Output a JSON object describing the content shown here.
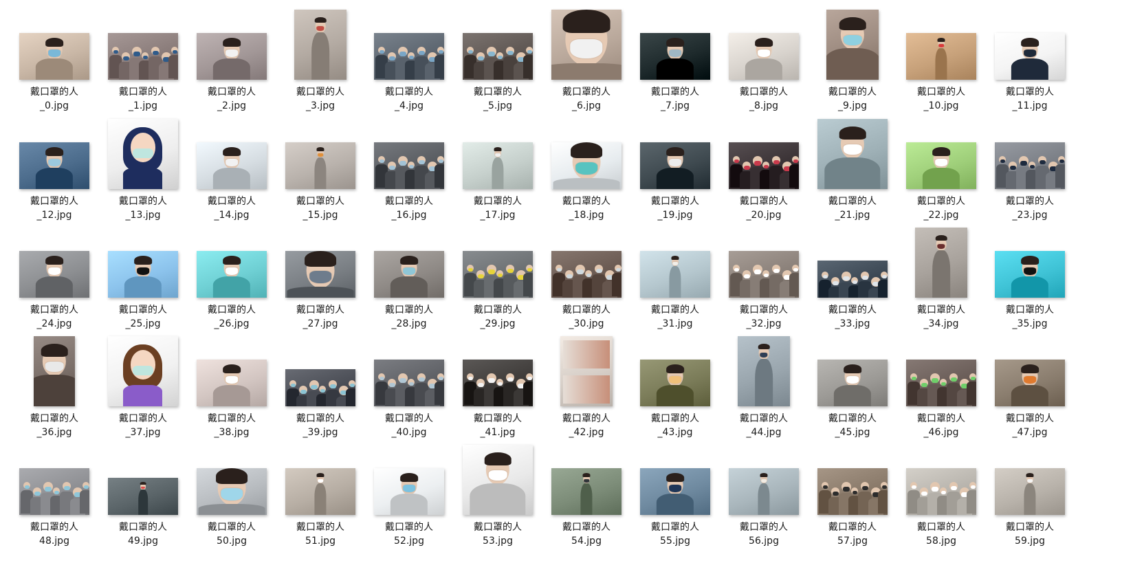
{
  "window": {
    "view": "large-icons",
    "background": "#ffffff"
  },
  "files": [
    {
      "name_line1": "戴口罩的人",
      "name_line2": "_0.jpg",
      "thumb": {
        "shape": "landscape",
        "bg": "#c9b7a6",
        "accent": "#7ab8d8",
        "kind": "portrait"
      }
    },
    {
      "name_line1": "戴口罩的人",
      "name_line2": "_1.jpg",
      "thumb": {
        "shape": "landscape",
        "bg": "#8a7c7a",
        "accent": "#2f5b8a",
        "kind": "crowd"
      }
    },
    {
      "name_line1": "戴口罩的人",
      "name_line2": "_2.jpg",
      "thumb": {
        "shape": "landscape",
        "bg": "#a29797",
        "accent": "#f2f2f2",
        "kind": "portrait"
      }
    },
    {
      "name_line1": "戴口罩的人",
      "name_line2": "_3.jpg",
      "thumb": {
        "shape": "portrait",
        "bg": "#b3aaa2",
        "accent": "#c24d44",
        "kind": "walker"
      }
    },
    {
      "name_line1": "戴口罩的人",
      "name_line2": "_4.jpg",
      "thumb": {
        "shape": "landscape",
        "bg": "#5d6670",
        "accent": "#7aa6c6",
        "kind": "crowd"
      }
    },
    {
      "name_line1": "戴口罩的人",
      "name_line2": "_5.jpg",
      "thumb": {
        "shape": "landscape",
        "bg": "#5f5753",
        "accent": "#89b7cf",
        "kind": "crowd"
      }
    },
    {
      "name_line1": "戴口罩的人",
      "name_line2": "_6.jpg",
      "thumb": {
        "shape": "square",
        "bg": "#b9a89b",
        "accent": "#f1f1f1",
        "kind": "closeup"
      }
    },
    {
      "name_line1": "戴口罩的人",
      "name_line2": "_7.jpg",
      "thumb": {
        "shape": "landscape",
        "bg": "#1e2a2c",
        "accent": "#9fb7c4",
        "kind": "portrait"
      }
    },
    {
      "name_line1": "戴口罩的人",
      "name_line2": "_8.jpg",
      "thumb": {
        "shape": "landscape",
        "bg": "#d8d3cd",
        "accent": "#ffffff",
        "kind": "portrait"
      }
    },
    {
      "name_line1": "戴口罩的人",
      "name_line2": "_9.jpg",
      "thumb": {
        "shape": "portrait",
        "bg": "#9c8a7f",
        "accent": "#8fd0e0",
        "kind": "portrait"
      }
    },
    {
      "name_line1": "戴口罩的人",
      "name_line2": "_10.jpg",
      "thumb": {
        "shape": "landscape",
        "bg": "#c7a17a",
        "accent": "#d93a3a",
        "kind": "walker"
      }
    },
    {
      "name_line1": "戴口罩的人",
      "name_line2": "_11.jpg",
      "thumb": {
        "shape": "landscape",
        "bg": "#f4f4f4",
        "accent": "#1f2a3a",
        "kind": "suit"
      }
    },
    {
      "name_line1": "戴口罩的人",
      "name_line2": "_12.jpg",
      "thumb": {
        "shape": "landscape",
        "bg": "#4c6c8c",
        "accent": "#9cc9de",
        "kind": "portrait"
      }
    },
    {
      "name_line1": "戴口罩的人",
      "name_line2": "_13.jpg",
      "thumb": {
        "shape": "square",
        "bg": "#eeeeee",
        "accent": "#1e2d5e",
        "kind": "cartoon"
      }
    },
    {
      "name_line1": "戴口罩的人",
      "name_line2": "_14.jpg",
      "thumb": {
        "shape": "landscape",
        "bg": "#d6dde2",
        "accent": "#f2f2f2",
        "kind": "portrait"
      }
    },
    {
      "name_line1": "戴口罩的人",
      "name_line2": "_15.jpg",
      "thumb": {
        "shape": "landscape",
        "bg": "#b9b2ac",
        "accent": "#e0903a",
        "kind": "walker"
      }
    },
    {
      "name_line1": "戴口罩的人",
      "name_line2": "_16.jpg",
      "thumb": {
        "shape": "landscape",
        "bg": "#5a5d62",
        "accent": "#a3c3d6",
        "kind": "crowd"
      }
    },
    {
      "name_line1": "戴口罩的人",
      "name_line2": "_17.jpg",
      "thumb": {
        "shape": "landscape",
        "bg": "#c6d0cc",
        "accent": "#f0f0f0",
        "kind": "walker"
      }
    },
    {
      "name_line1": "戴口罩的人",
      "name_line2": "_18.jpg",
      "thumb": {
        "shape": "landscape",
        "bg": "#e7ecef",
        "accent": "#58c3c0",
        "kind": "closeup"
      }
    },
    {
      "name_line1": "戴口罩的人",
      "name_line2": "_19.jpg",
      "thumb": {
        "shape": "landscape",
        "bg": "#3f4a50",
        "accent": "#ececec",
        "kind": "portrait"
      }
    },
    {
      "name_line1": "戴口罩的人",
      "name_line2": "_20.jpg",
      "thumb": {
        "shape": "landscape",
        "bg": "#3b3336",
        "accent": "#c93a4c",
        "kind": "crowd"
      }
    },
    {
      "name_line1": "戴口罩的人",
      "name_line2": "_21.jpg",
      "thumb": {
        "shape": "square",
        "bg": "#9eb0b6",
        "accent": "#ffffff",
        "kind": "portrait"
      }
    },
    {
      "name_line1": "戴口罩的人",
      "name_line2": "_22.jpg",
      "thumb": {
        "shape": "landscape",
        "bg": "#9fcf7a",
        "accent": "#ffffff",
        "kind": "portrait"
      }
    },
    {
      "name_line1": "戴口罩的人",
      "name_line2": "_23.jpg",
      "thumb": {
        "shape": "landscape",
        "bg": "#7b7f86",
        "accent": "#1d2a3e",
        "kind": "crowd"
      }
    },
    {
      "name_line1": "戴口罩的人",
      "name_line2": "_24.jpg",
      "thumb": {
        "shape": "landscape",
        "bg": "#8d8f92",
        "accent": "#ffffff",
        "kind": "portrait"
      }
    },
    {
      "name_line1": "戴口罩的人",
      "name_line2": "_25.jpg",
      "thumb": {
        "shape": "landscape",
        "bg": "#8cc3ec",
        "accent": "#111111",
        "kind": "portrait"
      }
    },
    {
      "name_line1": "戴口罩的人",
      "name_line2": "_26.jpg",
      "thumb": {
        "shape": "landscape",
        "bg": "#6fd0d4",
        "accent": "#ffffff",
        "kind": "portrait"
      }
    },
    {
      "name_line1": "戴口罩的人",
      "name_line2": "_27.jpg",
      "thumb": {
        "shape": "landscape",
        "bg": "#7a7f84",
        "accent": "#6e7c8c",
        "kind": "closeup"
      }
    },
    {
      "name_line1": "戴口罩的人",
      "name_line2": "_28.jpg",
      "thumb": {
        "shape": "landscape",
        "bg": "#8f8a86",
        "accent": "#8fc7d7",
        "kind": "portrait"
      }
    },
    {
      "name_line1": "戴口罩的人",
      "name_line2": "_29.jpg",
      "thumb": {
        "shape": "landscape",
        "bg": "#6c7073",
        "accent": "#e6d43a",
        "kind": "crowd"
      }
    },
    {
      "name_line1": "戴口罩的人",
      "name_line2": "_30.jpg",
      "thumb": {
        "shape": "landscape",
        "bg": "#6a5a52",
        "accent": "#cfd9de",
        "kind": "crowd"
      }
    },
    {
      "name_line1": "戴口罩的人",
      "name_line2": "_31.jpg",
      "thumb": {
        "shape": "landscape",
        "bg": "#b5c7ce",
        "accent": "#f2efe9",
        "kind": "walker"
      }
    },
    {
      "name_line1": "戴口罩的人",
      "name_line2": "_32.jpg",
      "thumb": {
        "shape": "landscape",
        "bg": "#8b817a",
        "accent": "#ffffff",
        "kind": "crowd"
      }
    },
    {
      "name_line1": "戴口罩的人",
      "name_line2": "_33.jpg",
      "thumb": {
        "shape": "landscape-short",
        "bg": "#3e4a56",
        "accent": "#dfe5ea",
        "kind": "crowd"
      }
    },
    {
      "name_line1": "戴口罩的人",
      "name_line2": "_34.jpg",
      "thumb": {
        "shape": "portrait",
        "bg": "#a8a29c",
        "accent": "#6a2e2e",
        "kind": "walker"
      }
    },
    {
      "name_line1": "戴口罩的人",
      "name_line2": "_35.jpg",
      "thumb": {
        "shape": "landscape",
        "bg": "#3fc3d6",
        "accent": "#111111",
        "kind": "portrait"
      }
    },
    {
      "name_line1": "戴口罩的人",
      "name_line2": "_36.jpg",
      "thumb": {
        "shape": "portrait-narrow",
        "bg": "#7a6e68",
        "accent": "#e9e9e9",
        "kind": "portrait"
      }
    },
    {
      "name_line1": "戴口罩的人",
      "name_line2": "_37.jpg",
      "thumb": {
        "shape": "square",
        "bg": "#f1f1f1",
        "accent": "#8a5cc9",
        "kind": "cartoon"
      }
    },
    {
      "name_line1": "戴口罩的人",
      "name_line2": "_38.jpg",
      "thumb": {
        "shape": "landscape",
        "bg": "#d3c6c2",
        "accent": "#ffffff",
        "kind": "portrait"
      }
    },
    {
      "name_line1": "戴口罩的人",
      "name_line2": "_39.jpg",
      "thumb": {
        "shape": "landscape-short",
        "bg": "#4c4f57",
        "accent": "#8cc4d4",
        "kind": "crowd"
      }
    },
    {
      "name_line1": "戴口罩的人",
      "name_line2": "_40.jpg",
      "thumb": {
        "shape": "landscape",
        "bg": "#5f6166",
        "accent": "#b1c7d4",
        "kind": "crowd"
      }
    },
    {
      "name_line1": "戴口罩的人",
      "name_line2": "_41.jpg",
      "thumb": {
        "shape": "landscape",
        "bg": "#3f3c3a",
        "accent": "#f3f3f3",
        "kind": "crowd"
      }
    },
    {
      "name_line1": "戴口罩的人",
      "name_line2": "_42.jpg",
      "thumb": {
        "shape": "portrait",
        "bg": "#d7cfc8",
        "accent": "#c78f79",
        "kind": "collage"
      }
    },
    {
      "name_line1": "戴口罩的人",
      "name_line2": "_43.jpg",
      "thumb": {
        "shape": "landscape",
        "bg": "#7b7c59",
        "accent": "#f0c07a",
        "kind": "portrait"
      }
    },
    {
      "name_line1": "戴口罩的人",
      "name_line2": "_44.jpg",
      "thumb": {
        "shape": "portrait",
        "bg": "#9aa6ae",
        "accent": "#2e3e55",
        "kind": "walker"
      }
    },
    {
      "name_line1": "戴口罩的人",
      "name_line2": "_45.jpg",
      "thumb": {
        "shape": "landscape",
        "bg": "#9c9a96",
        "accent": "#ffffff",
        "kind": "portrait"
      }
    },
    {
      "name_line1": "戴口罩的人",
      "name_line2": "_46.jpg",
      "thumb": {
        "shape": "landscape",
        "bg": "#6a5d58",
        "accent": "#6fcf6a",
        "kind": "crowd"
      }
    },
    {
      "name_line1": "戴口罩的人",
      "name_line2": "_47.jpg",
      "thumb": {
        "shape": "landscape",
        "bg": "#8a7d6e",
        "accent": "#e07a2e",
        "kind": "portrait"
      }
    },
    {
      "name_line1": "戴口罩的人",
      "name_line2": "48.jpg",
      "thumb": {
        "shape": "landscape",
        "bg": "#8e8f93",
        "accent": "#8ec6d9",
        "kind": "crowd"
      }
    },
    {
      "name_line1": "戴口罩的人",
      "name_line2": "49.jpg",
      "thumb": {
        "shape": "landscape-short",
        "bg": "#5a6468",
        "accent": "#e04d4d",
        "kind": "walker"
      }
    },
    {
      "name_line1": "戴口罩的人",
      "name_line2": "50.jpg",
      "thumb": {
        "shape": "landscape",
        "bg": "#b8bcc0",
        "accent": "#9fd6ea",
        "kind": "closeup"
      }
    },
    {
      "name_line1": "戴口罩的人",
      "name_line2": "51.jpg",
      "thumb": {
        "shape": "landscape",
        "bg": "#b7aea4",
        "accent": "#ffffff",
        "kind": "walker"
      }
    },
    {
      "name_line1": "戴口罩的人",
      "name_line2": "52.jpg",
      "thumb": {
        "shape": "landscape",
        "bg": "#eceff1",
        "accent": "#7cc2e0",
        "kind": "portrait"
      }
    },
    {
      "name_line1": "戴口罩的人",
      "name_line2": "53.jpg",
      "thumb": {
        "shape": "square",
        "bg": "#e9e9e9",
        "accent": "#ffffff",
        "kind": "portrait"
      }
    },
    {
      "name_line1": "戴口罩的人",
      "name_line2": "54.jpg",
      "thumb": {
        "shape": "landscape",
        "bg": "#7c8c78",
        "accent": "#30353a",
        "kind": "walker"
      }
    },
    {
      "name_line1": "戴口罩的人",
      "name_line2": "55.jpg",
      "thumb": {
        "shape": "landscape",
        "bg": "#6f8aa0",
        "accent": "#1f3658",
        "kind": "portrait"
      }
    },
    {
      "name_line1": "戴口罩的人",
      "name_line2": "56.jpg",
      "thumb": {
        "shape": "landscape",
        "bg": "#a9b6bc",
        "accent": "#f1ece4",
        "kind": "walker"
      }
    },
    {
      "name_line1": "戴口罩的人",
      "name_line2": "57.jpg",
      "thumb": {
        "shape": "landscape",
        "bg": "#8a7a6a",
        "accent": "#2c2c2c",
        "kind": "crowd"
      }
    },
    {
      "name_line1": "戴口罩的人",
      "name_line2": "58.jpg",
      "thumb": {
        "shape": "landscape",
        "bg": "#b8b4ad",
        "accent": "#ffffff",
        "kind": "crowd"
      }
    },
    {
      "name_line1": "戴口罩的人",
      "name_line2": "59.jpg",
      "thumb": {
        "shape": "landscape",
        "bg": "#b8b2aa",
        "accent": "#f4f4f4",
        "kind": "walker"
      }
    }
  ]
}
